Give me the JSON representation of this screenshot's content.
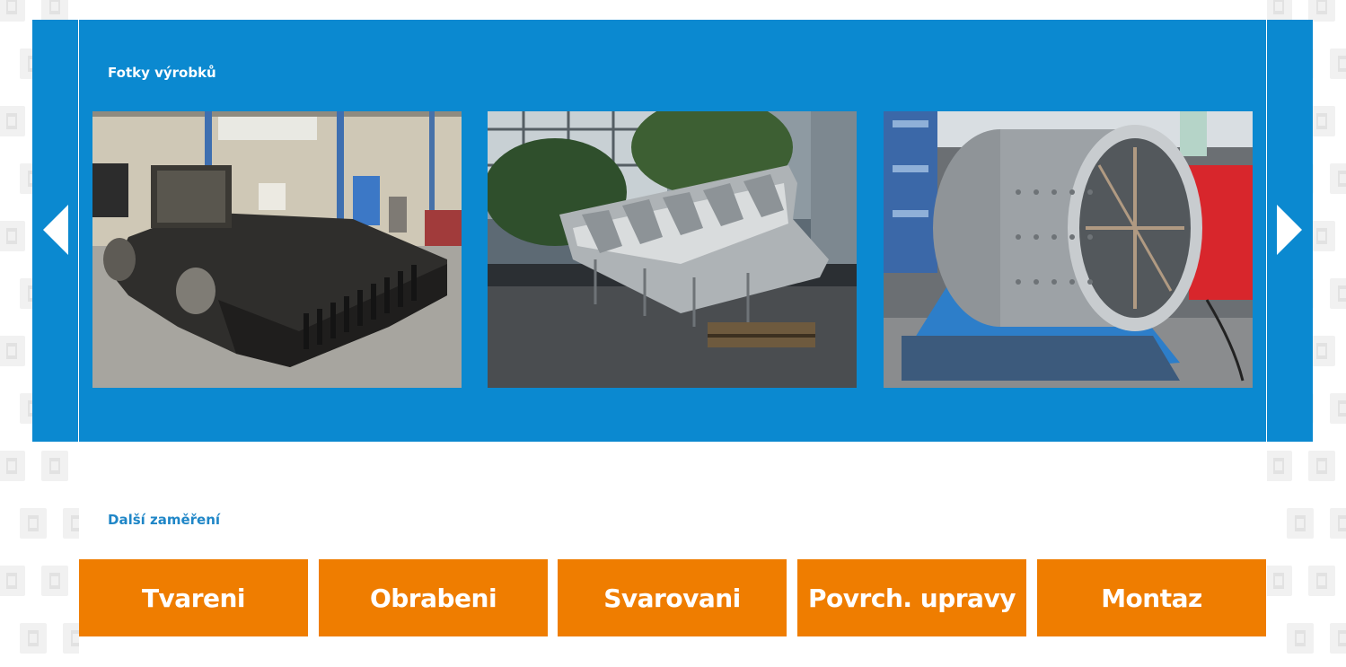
{
  "gallery": {
    "title": "Fotky výrobků",
    "background_color": "#0b89d0",
    "prev_icon": "chevron-left-icon",
    "next_icon": "chevron-right-icon",
    "photos": [
      {
        "subject": "dark steel welded vehicle body in workshop"
      },
      {
        "subject": "stainless steel hopper frames on pallet outdoors"
      },
      {
        "subject": "perforated stainless steel drum on blue stand"
      }
    ]
  },
  "focus": {
    "title": "Další zaměření",
    "title_color": "#1f86c7",
    "button_color": "#ef7d00",
    "items": [
      {
        "label": "Tvareni"
      },
      {
        "label": "Obrabeni"
      },
      {
        "label": "Svarovani"
      },
      {
        "label": "Povrch. upravy"
      },
      {
        "label": "Montaz"
      }
    ]
  }
}
